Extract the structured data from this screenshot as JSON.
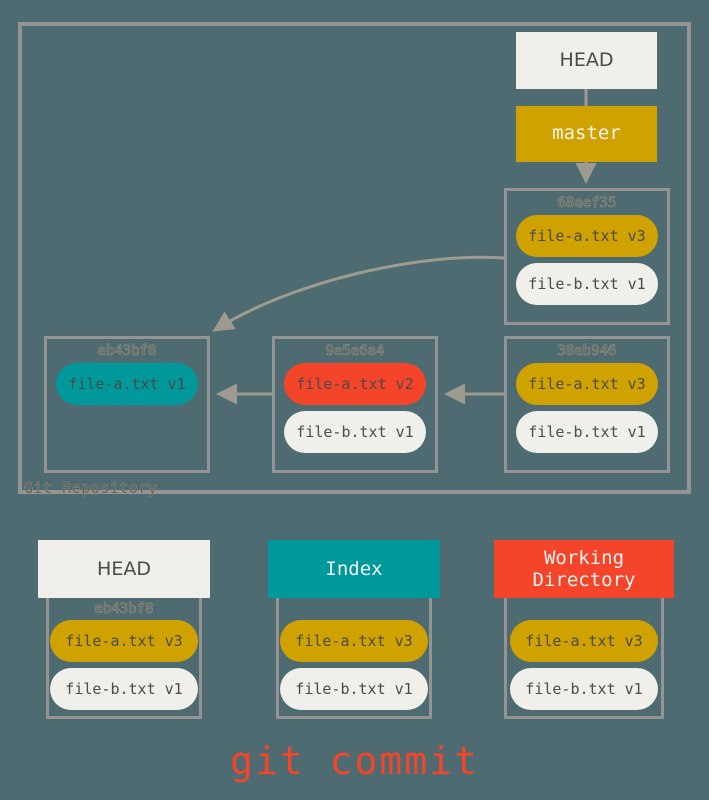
{
  "background_color": "#4d6b70",
  "border_color": "#949494",
  "palette": {
    "gold": "#cfa200",
    "cream": "#f0efe9",
    "teal": "#00999b",
    "red": "#f4452b",
    "hash_text": "#6d6a5e",
    "body_text": "#4b4b4b"
  },
  "repository": {
    "label": "Git Repository",
    "refs": {
      "head_label": "HEAD",
      "branch_label": "master"
    },
    "commits": [
      {
        "id": "c-68aef35",
        "hash": "68aef35",
        "blobs": [
          {
            "label": "file-a.txt v3",
            "color": "gold"
          },
          {
            "label": "file-b.txt v1",
            "color": "cream"
          }
        ]
      },
      {
        "id": "c-eb43bf8",
        "hash": "eb43bf8",
        "blobs": [
          {
            "label": "file-a.txt v1",
            "color": "teal"
          }
        ]
      },
      {
        "id": "c-9e5e6a4",
        "hash": "9e5e6a4",
        "blobs": [
          {
            "label": "file-a.txt v2",
            "color": "red"
          },
          {
            "label": "file-b.txt v1",
            "color": "cream"
          }
        ]
      },
      {
        "id": "c-38eb946",
        "hash": "38eb946",
        "blobs": [
          {
            "label": "file-a.txt v3",
            "color": "gold"
          },
          {
            "label": "file-b.txt v1",
            "color": "cream"
          }
        ]
      }
    ]
  },
  "states": [
    {
      "id": "col-head",
      "title": "HEAD",
      "header_color": "#f0efe9",
      "hash": "eb43bf8",
      "blobs": [
        {
          "label": "file-a.txt v3",
          "color": "gold"
        },
        {
          "label": "file-b.txt v1",
          "color": "cream"
        }
      ]
    },
    {
      "id": "col-index",
      "title": "Index",
      "header_color": "#00999b",
      "hash": "",
      "blobs": [
        {
          "label": "file-a.txt v3",
          "color": "gold"
        },
        {
          "label": "file-b.txt v1",
          "color": "cream"
        }
      ]
    },
    {
      "id": "col-wd",
      "title": "Working\nDirectory",
      "header_color": "#f4452b",
      "hash": "",
      "blobs": [
        {
          "label": "file-a.txt v3",
          "color": "gold"
        },
        {
          "label": "file-b.txt v1",
          "color": "cream"
        }
      ]
    }
  ],
  "caption": "git commit"
}
